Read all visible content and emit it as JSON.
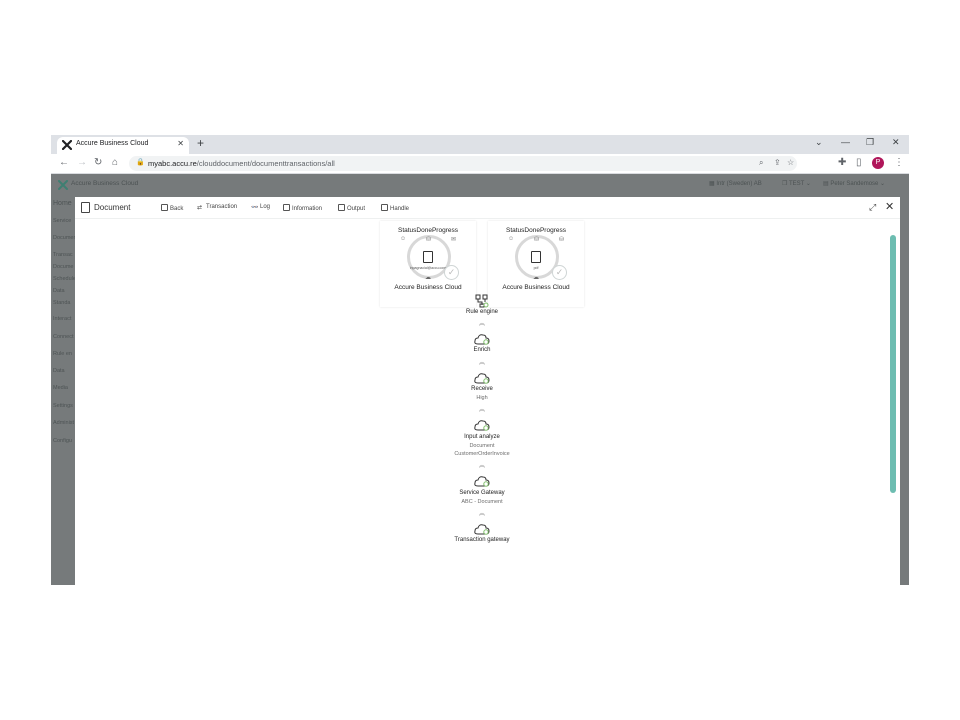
{
  "browser": {
    "tab_title": "Accure Business Cloud",
    "url_host": "myabc.accu.re",
    "url_path": "/clouddocument/documenttransactions/all",
    "profile_initial": "P",
    "colors": {
      "tabstrip": "#dee1e6",
      "profile": "#b0165a"
    }
  },
  "app": {
    "title": "Accure Business Cloud",
    "header": {
      "company": "Intr (Sweden) AB",
      "env": "TEST",
      "user": "Peter Sandemose"
    },
    "sidebar": [
      "Home",
      "Service",
      "Document",
      "Transac",
      "Docume",
      "Schedule",
      "Data",
      "Standa",
      "Interact",
      "Connect",
      "Rule en",
      "Data",
      "Media",
      "Settings",
      "Administ",
      "Configu"
    ],
    "overlay_color": "#767a7b"
  },
  "modal": {
    "title": "Document",
    "toolbar": [
      {
        "label": "Back",
        "icon": "back-icon"
      },
      {
        "label": "Transaction",
        "icon": "transaction-icon"
      },
      {
        "label": "Log",
        "icon": "log-icon"
      },
      {
        "label": "Information",
        "icon": "information-icon"
      },
      {
        "label": "Output",
        "icon": "output-icon"
      },
      {
        "label": "Handle",
        "icon": "handle-icon"
      }
    ],
    "scrollbar_color": "#6dbdb1",
    "cards": [
      {
        "status": "StatusDoneProgress",
        "doc_name": "inpagnacial@accu.com",
        "name": "Accure Business Cloud"
      },
      {
        "status": "StatusDoneProgress",
        "doc_name": "pdf",
        "name": "Accure Business Cloud"
      }
    ],
    "flow": [
      {
        "label": "Rule engine",
        "sub": [],
        "icon": "rule-engine-icon"
      },
      {
        "label": "Enrich",
        "sub": [],
        "icon": "cloud-icon"
      },
      {
        "label": "Receive",
        "sub": [
          "High"
        ],
        "icon": "cloud-icon"
      },
      {
        "label": "Input analyze",
        "sub": [
          "Document",
          "CustomerOrderInvoice"
        ],
        "icon": "cloud-icon"
      },
      {
        "label": "Service Gateway",
        "sub": [
          "ABC - Document"
        ],
        "icon": "cloud-icon"
      },
      {
        "label": "Transaction gateway",
        "sub": [],
        "icon": "cloud-icon"
      }
    ]
  }
}
